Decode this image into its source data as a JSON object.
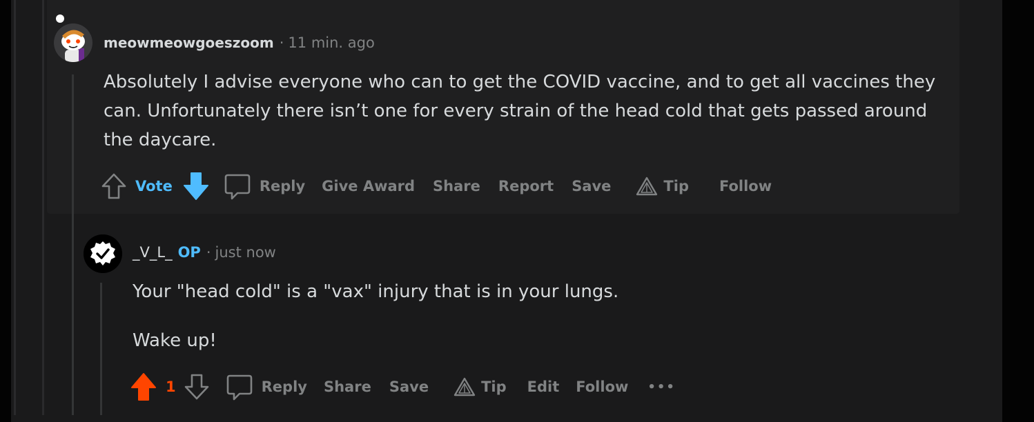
{
  "comment1": {
    "username": "meowmeowgoeszoom",
    "separator": "·",
    "timestamp": "11 min. ago",
    "body": "Absolutely I advise everyone who can to get the COVID vaccine, and to get all vaccines they can. Unfortunately there isn’t one for every strain of the head cold that gets passed around the daycare.",
    "actions": {
      "vote": "Vote",
      "reply": "Reply",
      "give_award": "Give Award",
      "share": "Share",
      "report": "Report",
      "save": "Save",
      "tip": "Tip",
      "follow": "Follow"
    },
    "vote_state": "downvoted",
    "colors": {
      "vote_active": "#4fbcff"
    }
  },
  "comment2": {
    "username": "_V_L_",
    "op_badge": "OP",
    "separator": "·",
    "timestamp": "just now",
    "paragraphs": [
      "Your \"head cold\" is a \"vax\" injury that is in your lungs.",
      "Wake up!"
    ],
    "score": "1",
    "vote_state": "upvoted",
    "actions": {
      "reply": "Reply",
      "share": "Share",
      "save": "Save",
      "tip": "Tip",
      "edit": "Edit",
      "follow": "Follow",
      "more": "•••"
    },
    "colors": {
      "upvote_active": "#ff4500"
    }
  },
  "icons": [
    "upvote-icon",
    "downvote-icon",
    "reply-bubble-icon",
    "tip-triangle-icon",
    "more-options-icon",
    "verified-check-icon"
  ]
}
